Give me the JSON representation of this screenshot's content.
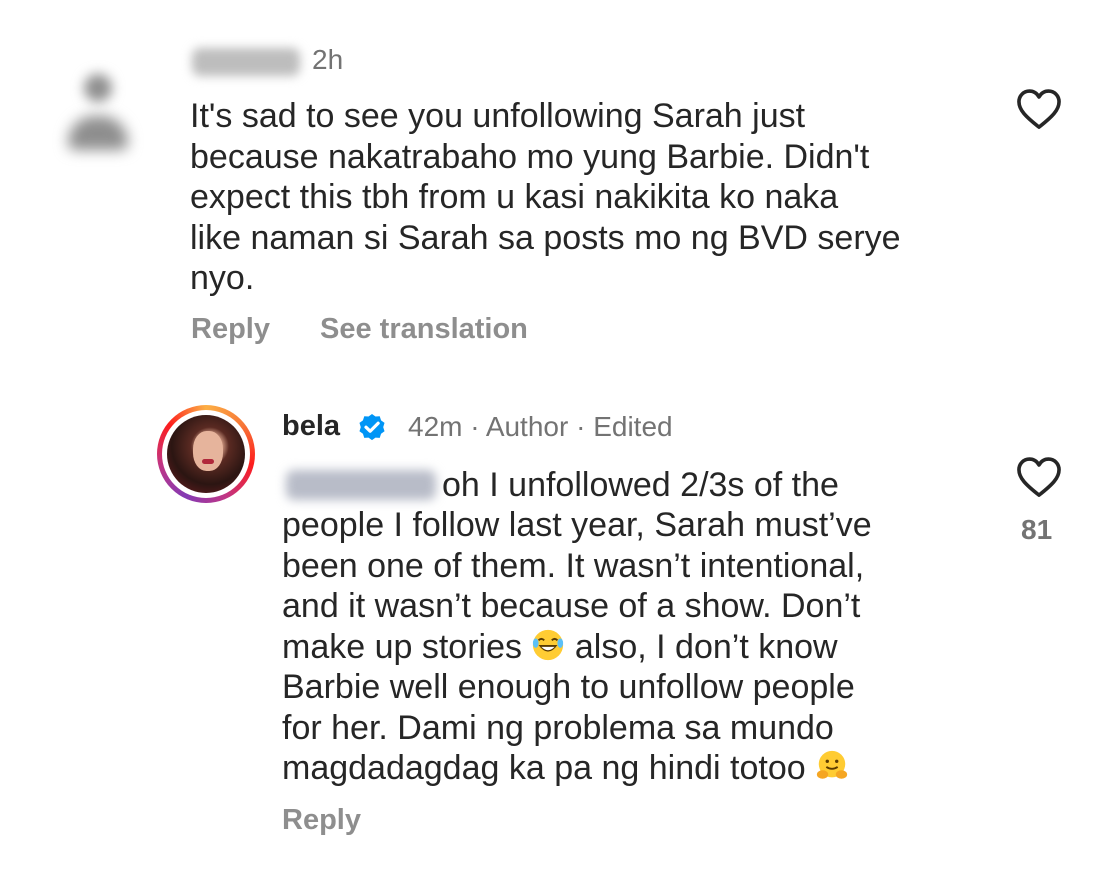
{
  "comment1": {
    "time": "2h",
    "text": "It's sad to see you unfollowing Sarah just\nbecause nakatrabaho mo yung Barbie. Didn't\nexpect this tbh from u kasi nakikita ko naka\nlike naman si Sarah sa posts mo ng BVD serye\nnyo.",
    "reply_label": "Reply",
    "translate_label": "See translation"
  },
  "reply": {
    "username": "bela",
    "time": "42m",
    "sep1": "·",
    "author_label": "Author",
    "sep2": "·",
    "edited_label": "Edited",
    "line1": "oh I unfollowed 2/3s of the",
    "lines_a": "people I follow last year, Sarah must’ve\nbeen one of them. It wasn’t intentional,\nand it wasn’t because of a show. Don’t",
    "line_make_pre": "make up stories ",
    "line_make_post": " also, I don’t know",
    "lines_b": "Barbie well enough to unfollow people\nfor her. Dami ng problema sa mundo",
    "line_last": "magdadagdag ka pa ng hindi totoo ",
    "reply_label": "Reply",
    "like_count": "81"
  },
  "colors": {
    "verified": "#0095f6",
    "muted": "#737373",
    "text": "#262626"
  },
  "icons": [
    "heart-outline-icon",
    "verified-badge-icon",
    "laughing-emoji-icon",
    "hug-emoji-icon"
  ]
}
